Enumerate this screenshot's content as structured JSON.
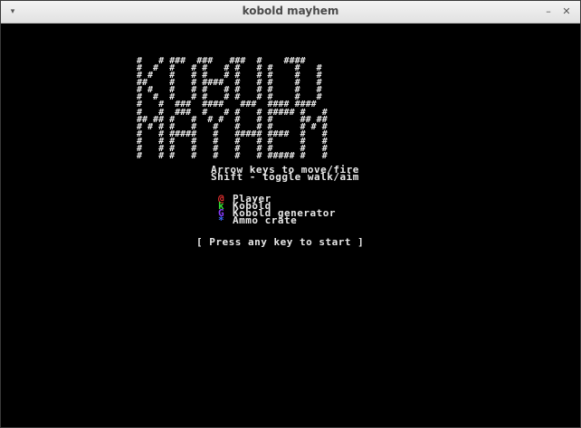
{
  "window": {
    "title": "kobold mayhem",
    "menu_glyph": "▾",
    "minimize_glyph": "–",
    "close_glyph": "✕"
  },
  "banner": {
    "line1": "#   # ###  ###   ###  #    ####\n#  #  #   # #   # #   # #    #   #\n# #   #   # #   # #   # #    #   #\n##    #   # ####  #   # #    #   #\n# #   #   # #   # #   # #    #   #\n#  #  #   # #   # #   # #    #   #\n#   #  ###  ####   ###  #### ####",
    "line2": "#   #  ###  #   # #   # ##### #   #\n## ## #   #  # #  #   # #     ## ##\n# # # #   #   #   #   # #     # # #\n#   # #####   #   ##### ####  #   #\n#   # #   #   #   #   # #     #   #\n#   # #   #   #   #   # #     #   #\n#   # #   #   #   #   # ##### #   #"
  },
  "instructions": [
    "Arrow keys to move/fire",
    "Shift - toggle walk/aim"
  ],
  "legend": [
    {
      "symbol": "@",
      "label": "Player",
      "color": "#e83030"
    },
    {
      "symbol": "k",
      "label": "Kobold",
      "color": "#34e034"
    },
    {
      "symbol": "G",
      "label": "Kobold generator",
      "color": "#8a3cff"
    },
    {
      "symbol": "*",
      "label": "Ammo crate",
      "color": "#3c6cff"
    }
  ],
  "prompt": "[ Press any key to start ]"
}
